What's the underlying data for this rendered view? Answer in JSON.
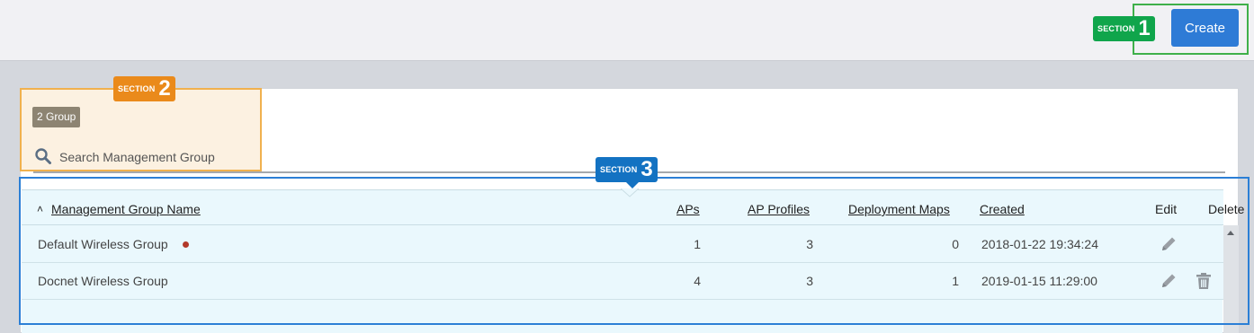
{
  "toolbar": {
    "create_label": "Create"
  },
  "sections": {
    "s1_label": "SECTION",
    "s1_num": "1",
    "s2_label": "SECTION",
    "s2_num": "2",
    "s3_label": "SECTION",
    "s3_num": "3"
  },
  "filter": {
    "group_count_badge": "2 Group",
    "search_placeholder": "Search Management Group"
  },
  "table": {
    "columns": {
      "name": "Management Group Name",
      "aps": "APs",
      "ap_profiles": "AP Profiles",
      "deployment_maps": "Deployment Maps",
      "created": "Created",
      "edit": "Edit",
      "delete": "Delete"
    },
    "rows": [
      {
        "name": "Default Wireless Group",
        "aps": "1",
        "ap_profiles": "3",
        "deployment_maps": "0",
        "created": "2018-01-22 19:34:24"
      },
      {
        "name": "Docnet Wireless Group",
        "aps": "4",
        "ap_profiles": "3",
        "deployment_maps": "1",
        "created": "2019-01-15 11:29:00"
      }
    ]
  },
  "icons": {
    "sort": "chevron-up-icon",
    "search": "search-icon",
    "edit": "pencil-icon",
    "delete": "trash-icon"
  },
  "colors": {
    "primary": "#2e7bd6",
    "section1": "#10a54b",
    "section2": "#ea8a1b",
    "section3": "#1372c2",
    "status_dot": "#b23a2a"
  }
}
